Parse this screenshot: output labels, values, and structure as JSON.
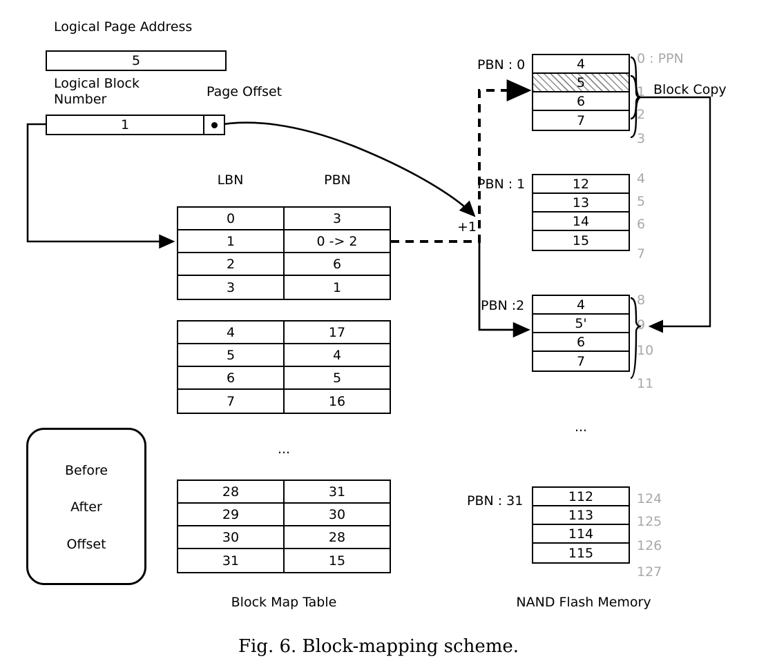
{
  "figure": {
    "caption": "Fig. 6.   Block-mapping scheme."
  },
  "labels": {
    "logical_page_address": "Logical Page Address",
    "logical_block_number": "Logical Block\nNumber",
    "page_offset": "Page Offset",
    "lbn_header": "LBN",
    "pbn_header": "PBN",
    "block_map_table": "Block Map Table",
    "nand_flash_memory": "NAND Flash Memory",
    "ellipsis_table": "...",
    "ellipsis_nand": "...",
    "plus_one": "+1",
    "block_copy": "Block Copy",
    "ppn_legend": "0 : PPN"
  },
  "address": {
    "logical_page_address_value": "5",
    "logical_block_number_value": "1",
    "page_offset_value": ""
  },
  "block_map_table": {
    "columns": [
      "LBN",
      "PBN"
    ],
    "groups": [
      {
        "rows": [
          {
            "lbn": "0",
            "pbn": "3"
          },
          {
            "lbn": "1",
            "pbn": "0 -> 2"
          },
          {
            "lbn": "2",
            "pbn": "6"
          },
          {
            "lbn": "3",
            "pbn": "1"
          }
        ]
      },
      {
        "rows": [
          {
            "lbn": "4",
            "pbn": "17"
          },
          {
            "lbn": "5",
            "pbn": "4"
          },
          {
            "lbn": "6",
            "pbn": "5"
          },
          {
            "lbn": "7",
            "pbn": "16"
          }
        ]
      },
      {
        "rows": [
          {
            "lbn": "28",
            "pbn": "31"
          },
          {
            "lbn": "29",
            "pbn": "30"
          },
          {
            "lbn": "30",
            "pbn": "28"
          },
          {
            "lbn": "31",
            "pbn": "15"
          }
        ]
      }
    ]
  },
  "nand": {
    "blocks": [
      {
        "label": "PBN : 0",
        "pages": [
          {
            "value": "4",
            "ppn": "0",
            "hatched": false
          },
          {
            "value": "5",
            "ppn": "1",
            "hatched": true
          },
          {
            "value": "6",
            "ppn": "2",
            "hatched": false
          },
          {
            "value": "7",
            "ppn": "3",
            "hatched": false
          }
        ]
      },
      {
        "label": "PBN : 1",
        "pages": [
          {
            "value": "12",
            "ppn": "4",
            "hatched": false
          },
          {
            "value": "13",
            "ppn": "5",
            "hatched": false
          },
          {
            "value": "14",
            "ppn": "6",
            "hatched": false
          },
          {
            "value": "15",
            "ppn": "7",
            "hatched": false
          }
        ]
      },
      {
        "label": "PBN :2",
        "pages": [
          {
            "value": "4",
            "ppn": "8",
            "hatched": false
          },
          {
            "value": "5'",
            "ppn": "9",
            "hatched": false
          },
          {
            "value": "6",
            "ppn": "10",
            "hatched": false
          },
          {
            "value": "7",
            "ppn": "11",
            "hatched": false
          }
        ]
      },
      {
        "label": "PBN : 31",
        "pages": [
          {
            "value": "112",
            "ppn": "124",
            "hatched": false
          },
          {
            "value": "113",
            "ppn": "125",
            "hatched": false
          },
          {
            "value": "114",
            "ppn": "126",
            "hatched": false
          },
          {
            "value": "115",
            "ppn": "127",
            "hatched": false
          }
        ]
      }
    ]
  },
  "legend": {
    "items": [
      {
        "label": "Before",
        "style": "dashed-arrow"
      },
      {
        "label": "After",
        "style": "solid-arrow"
      },
      {
        "label": "Offset",
        "style": "dot-arrow"
      }
    ]
  },
  "colors": {
    "ink": "#000000",
    "ppn_gray": "#a8a8a8",
    "hatch": "#8a8a8a"
  }
}
